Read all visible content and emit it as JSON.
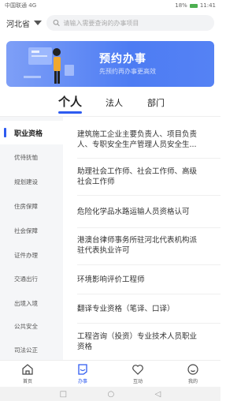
{
  "status_bar": {
    "carrier": "中国联通",
    "signal": "4G",
    "battery": "18%",
    "time": "11:41"
  },
  "header": {
    "province": "河北省",
    "search_placeholder": "请输入需要查询的办事项目"
  },
  "banner": {
    "title": "预约办事",
    "subtitle": "先预约再办事更高效"
  },
  "tabs": [
    {
      "label": "个人",
      "active": true
    },
    {
      "label": "法人",
      "active": false
    },
    {
      "label": "部门",
      "active": false
    }
  ],
  "sidebar": {
    "items": [
      {
        "label": "职业资格",
        "active": true
      },
      {
        "label": "优待抚恤"
      },
      {
        "label": "规划建设"
      },
      {
        "label": "住房保障"
      },
      {
        "label": "社会保障"
      },
      {
        "label": "证件办理"
      },
      {
        "label": "交通出行"
      },
      {
        "label": "出境入境"
      },
      {
        "label": "公共安全"
      },
      {
        "label": "司法公正"
      }
    ]
  },
  "list": {
    "items": [
      {
        "line1": "建筑施工企业主要负责人、项目负责",
        "line2": "人、专职安全生产管理人员安全生..."
      },
      {
        "line1": "助理社会工作师、社会工作师、高级",
        "line2": "社会工作师"
      },
      {
        "line1": "危险化学品水路运输人员资格认可",
        "line2": ""
      },
      {
        "line1": "港澳台律师事务所驻河北代表机构派",
        "line2": "驻代表执业许可"
      },
      {
        "line1": "环境影响评价工程师",
        "line2": ""
      },
      {
        "line1": "翻译专业资格（笔译、口译）",
        "line2": ""
      },
      {
        "line1": "工程咨询（投资）专业技术人员职业",
        "line2": "资格"
      }
    ]
  },
  "bottom_nav": [
    {
      "label": "首页",
      "icon": "home-icon",
      "active": false
    },
    {
      "label": "办事",
      "icon": "task-icon",
      "active": true
    },
    {
      "label": "互动",
      "icon": "heart-icon",
      "active": false
    },
    {
      "label": "我的",
      "icon": "user-icon",
      "active": false
    }
  ],
  "colors": {
    "accent": "#2e5bf0",
    "banner": "#5582f4"
  }
}
